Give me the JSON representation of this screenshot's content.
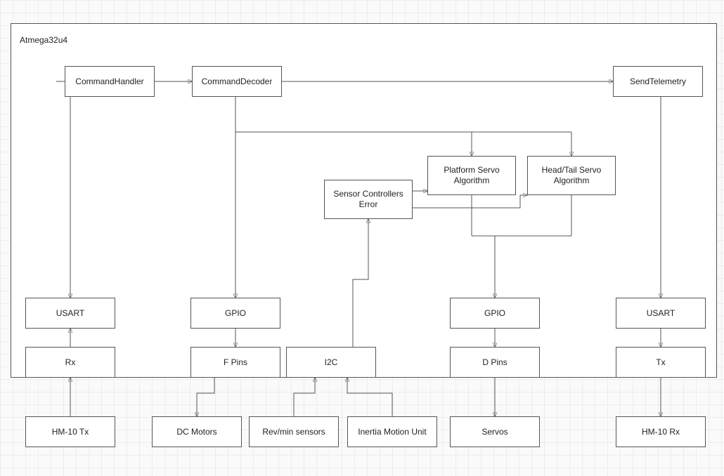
{
  "container": {
    "label": "Atmega32u4"
  },
  "boxes": {
    "commandHandler": "CommandHandler",
    "commandDecoder": "CommandDecoder",
    "sendTelemetry": "SendTelemetry",
    "platformServo": "Platform Servo Algorithm",
    "headTailServo": "Head/Tail Servo Algorithm",
    "sensorControllers": "Sensor Controllers Error",
    "usartLeft": "USART",
    "gpioLeft": "GPIO",
    "gpioRight": "GPIO",
    "usartRight": "USART",
    "rx": "Rx",
    "fPins": "F Pins",
    "i2c": "I2C",
    "dPins": "D Pins",
    "tx": "Tx",
    "hm10tx": "HM-10 Tx",
    "dcMotors": "DC Motors",
    "revmin": "Rev/min sensors",
    "imu": "Inertia Motion Unit",
    "servos": "Servos",
    "hm10rx": "HM-10 Rx"
  }
}
